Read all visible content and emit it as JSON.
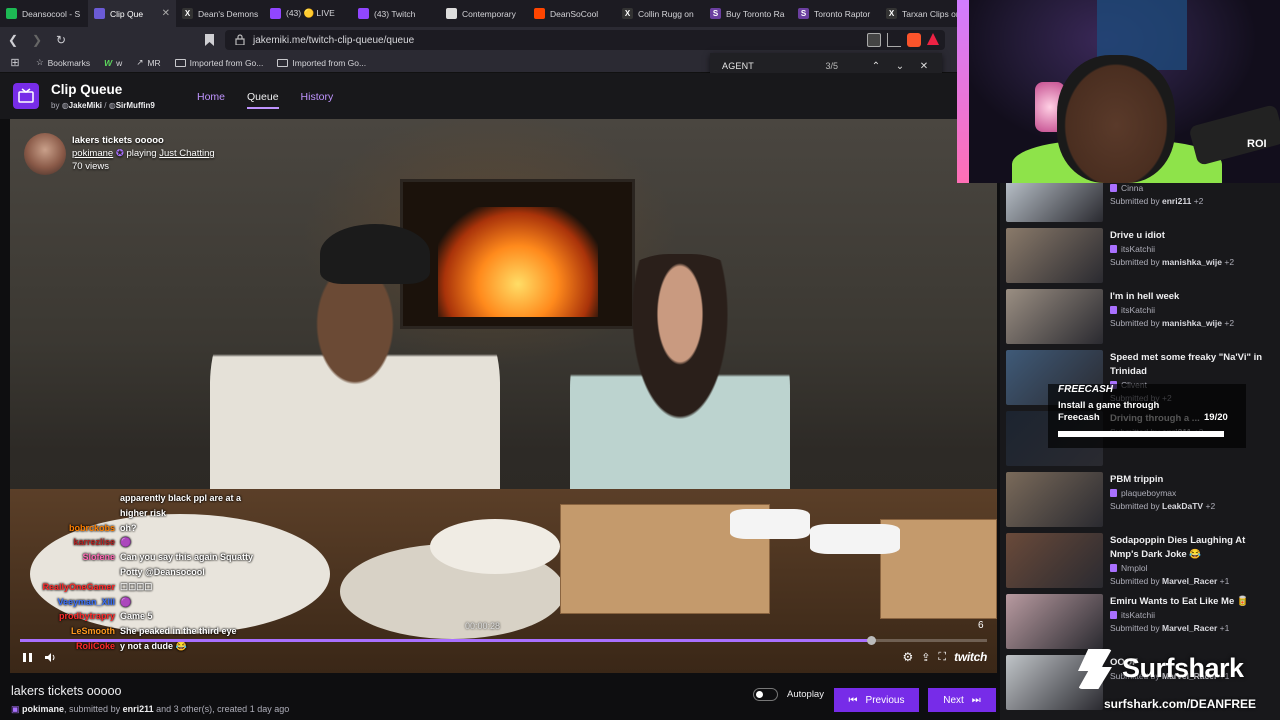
{
  "browser": {
    "tabs": [
      {
        "title": "Deansocool - S",
        "color": "#1db954",
        "glyph": "",
        "active": false
      },
      {
        "title": "Clip Que",
        "color": "#6b5bd6",
        "glyph": "",
        "active": true
      },
      {
        "title": "Dean's Demons",
        "color": "#333333",
        "glyph": "X",
        "active": false
      },
      {
        "title": "(43) 🟡 LIVE",
        "color": "#9146ff",
        "glyph": "",
        "active": false
      },
      {
        "title": "(43) Twitch",
        "color": "#9146ff",
        "glyph": "",
        "active": false
      },
      {
        "title": "Contemporary",
        "color": "#dddddd",
        "glyph": "",
        "active": false
      },
      {
        "title": "DeanSoCool",
        "color": "#ff4500",
        "glyph": "",
        "active": false
      },
      {
        "title": "Collin Rugg on",
        "color": "#333333",
        "glyph": "X",
        "active": false
      },
      {
        "title": "Buy Toronto Ra",
        "color": "#6b3fa0",
        "glyph": "S",
        "active": false
      },
      {
        "title": "Toronto Raptor",
        "color": "#6b3fa0",
        "glyph": "S",
        "active": false
      },
      {
        "title": "Tarxan Clips on",
        "color": "#333333",
        "glyph": "X",
        "active": false
      }
    ],
    "url": "jakemiki.me/twitch-clip-queue/queue",
    "bookmarks": [
      {
        "label": "Bookmarks",
        "type": "star"
      },
      {
        "label": "w",
        "type": "w"
      },
      {
        "label": "MR",
        "type": "mr"
      },
      {
        "label": "Imported from Go...",
        "type": "folder"
      },
      {
        "label": "Imported from Go...",
        "type": "folder"
      }
    ],
    "find": {
      "query": "AGENT",
      "count": "3/5"
    }
  },
  "app": {
    "title": "Clip Queue",
    "by_prefix": "by",
    "author1": "JakeMiki",
    "separator": "/",
    "author2": "SirMuffin9",
    "nav": [
      "Home",
      "Queue",
      "History"
    ],
    "active_nav": "Queue"
  },
  "clip": {
    "title": "lakers tickets ooooo",
    "streamer": "pokimane",
    "playing_label": "playing",
    "game": "Just Chatting",
    "views": "70 views",
    "timecode": "00:00:28",
    "counter": "6",
    "progress": 0.88
  },
  "chat": [
    {
      "user": "",
      "user_color": "#5ac8fa",
      "text": "apparently black ppl are at a"
    },
    {
      "user": "",
      "user_color": "#5ac8fa",
      "text": "higher risk"
    },
    {
      "user": "bobrckobs",
      "user_color": "#ff7f00",
      "text": "oh?"
    },
    {
      "user": "karrezlise",
      "user_color": "#b22222",
      "text": "🟣"
    },
    {
      "user": "Slofene",
      "user_color": "#ff69b4",
      "text": "Can you say this again Squatty"
    },
    {
      "user": "",
      "user_color": "#ffffff",
      "text": "Potty @Deansocool"
    },
    {
      "user": "ReallyOneGamer",
      "user_color": "#ff2a2a",
      "text": "☐☐☐☐"
    },
    {
      "user": "Veeyman_XIII",
      "user_color": "#3a6ff7",
      "text": "🟣"
    },
    {
      "user": "prodbytrapry",
      "user_color": "#ff2a2a",
      "text": "Game 5"
    },
    {
      "user": "LeSmooth",
      "user_color": "#ff9a1f",
      "text": "She peaked in the third eye"
    },
    {
      "user": "RoliCoke",
      "user_color": "#ff2a2a",
      "text": "y not a dude 😂"
    }
  ],
  "player": {
    "brand": "twitch"
  },
  "below": {
    "title": "lakers tickets ooooo",
    "channel": "pokimane",
    "submitted_text": ", submitted by",
    "submitter": "enri211",
    "rest": "and 3 other(s), created 1 day ago",
    "autoplay_label": "Autoplay",
    "prev_label": "Previous",
    "next_label": "Next"
  },
  "queue": [
    {
      "title": "",
      "channel": "Cinna",
      "submitter": "enri211",
      "extra": "+2",
      "thumb": "#b8c0c8"
    },
    {
      "title": "Drive u idiot",
      "channel": "itsKatchii",
      "submitter": "manishka_wije",
      "extra": "+2",
      "thumb": "#8a7a6a"
    },
    {
      "title": "I'm in hell week",
      "channel": "itsKatchii",
      "submitter": "manishka_wije",
      "extra": "+2",
      "thumb": "#9a8e82"
    },
    {
      "title": "Speed met some freaky \"Na'Vi\" in Trinidad",
      "channel": "Clivent",
      "submitter": "",
      "extra": "+2",
      "thumb": "#3f5a78"
    },
    {
      "title": "Driving through a ...",
      "channel": "",
      "submitter": "enri211",
      "extra": "+2",
      "thumb": "#1c2430"
    },
    {
      "title": "PBM trippin",
      "channel": "plaqueboymax",
      "submitter": "LeakDaTV",
      "extra": "+2",
      "thumb": "#7a6a5a"
    },
    {
      "title": "Sodapoppin Dies Laughing At Nmp's Dark Joke 😂",
      "channel": "Nmplol",
      "submitter": "Marvel_Racer",
      "extra": "+1",
      "thumb": "#6a4a3a"
    },
    {
      "title": "Emiru Wants to Eat Like Me 🥫",
      "channel": "itsKatchii",
      "submitter": "Marvel_Racer",
      "extra": "+1",
      "thumb": "#b89aa0"
    },
    {
      "title": "OOOF",
      "channel": "",
      "submitter": "Marvel_Racer",
      "extra": "+1",
      "thumb": "#c0c4c8"
    }
  ],
  "queue_labels": {
    "submitted_by": "Submitted by"
  },
  "ad": {
    "brand": "FREECASH",
    "text": "Install a game through Freecash",
    "count": "19/20"
  },
  "webcam": {
    "shirt_text": "ROI"
  },
  "sponsor": {
    "name": "Surfshark",
    "url": "surfshark.com/DEANFREE"
  }
}
